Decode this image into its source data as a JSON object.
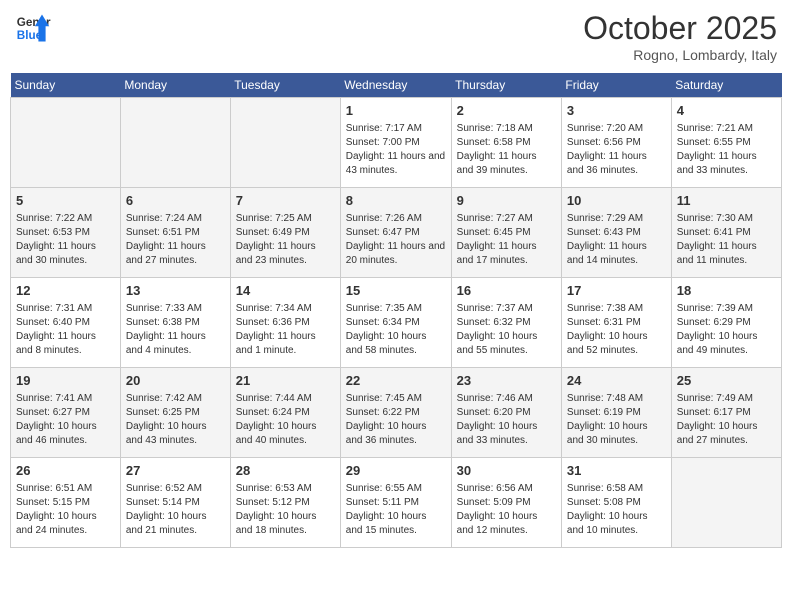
{
  "header": {
    "logo_general": "General",
    "logo_blue": "Blue",
    "month": "October 2025",
    "location": "Rogno, Lombardy, Italy"
  },
  "weekdays": [
    "Sunday",
    "Monday",
    "Tuesday",
    "Wednesday",
    "Thursday",
    "Friday",
    "Saturday"
  ],
  "weeks": [
    {
      "days": [
        {
          "num": "",
          "empty": true
        },
        {
          "num": "",
          "empty": true
        },
        {
          "num": "",
          "empty": true
        },
        {
          "num": "1",
          "sunrise": "7:17 AM",
          "sunset": "7:00 PM",
          "daylight": "11 hours and 43 minutes."
        },
        {
          "num": "2",
          "sunrise": "7:18 AM",
          "sunset": "6:58 PM",
          "daylight": "11 hours and 39 minutes."
        },
        {
          "num": "3",
          "sunrise": "7:20 AM",
          "sunset": "6:56 PM",
          "daylight": "11 hours and 36 minutes."
        },
        {
          "num": "4",
          "sunrise": "7:21 AM",
          "sunset": "6:55 PM",
          "daylight": "11 hours and 33 minutes."
        }
      ]
    },
    {
      "days": [
        {
          "num": "5",
          "sunrise": "7:22 AM",
          "sunset": "6:53 PM",
          "daylight": "11 hours and 30 minutes."
        },
        {
          "num": "6",
          "sunrise": "7:24 AM",
          "sunset": "6:51 PM",
          "daylight": "11 hours and 27 minutes."
        },
        {
          "num": "7",
          "sunrise": "7:25 AM",
          "sunset": "6:49 PM",
          "daylight": "11 hours and 23 minutes."
        },
        {
          "num": "8",
          "sunrise": "7:26 AM",
          "sunset": "6:47 PM",
          "daylight": "11 hours and 20 minutes."
        },
        {
          "num": "9",
          "sunrise": "7:27 AM",
          "sunset": "6:45 PM",
          "daylight": "11 hours and 17 minutes."
        },
        {
          "num": "10",
          "sunrise": "7:29 AM",
          "sunset": "6:43 PM",
          "daylight": "11 hours and 14 minutes."
        },
        {
          "num": "11",
          "sunrise": "7:30 AM",
          "sunset": "6:41 PM",
          "daylight": "11 hours and 11 minutes."
        }
      ]
    },
    {
      "days": [
        {
          "num": "12",
          "sunrise": "7:31 AM",
          "sunset": "6:40 PM",
          "daylight": "11 hours and 8 minutes."
        },
        {
          "num": "13",
          "sunrise": "7:33 AM",
          "sunset": "6:38 PM",
          "daylight": "11 hours and 4 minutes."
        },
        {
          "num": "14",
          "sunrise": "7:34 AM",
          "sunset": "6:36 PM",
          "daylight": "11 hours and 1 minute."
        },
        {
          "num": "15",
          "sunrise": "7:35 AM",
          "sunset": "6:34 PM",
          "daylight": "10 hours and 58 minutes."
        },
        {
          "num": "16",
          "sunrise": "7:37 AM",
          "sunset": "6:32 PM",
          "daylight": "10 hours and 55 minutes."
        },
        {
          "num": "17",
          "sunrise": "7:38 AM",
          "sunset": "6:31 PM",
          "daylight": "10 hours and 52 minutes."
        },
        {
          "num": "18",
          "sunrise": "7:39 AM",
          "sunset": "6:29 PM",
          "daylight": "10 hours and 49 minutes."
        }
      ]
    },
    {
      "days": [
        {
          "num": "19",
          "sunrise": "7:41 AM",
          "sunset": "6:27 PM",
          "daylight": "10 hours and 46 minutes."
        },
        {
          "num": "20",
          "sunrise": "7:42 AM",
          "sunset": "6:25 PM",
          "daylight": "10 hours and 43 minutes."
        },
        {
          "num": "21",
          "sunrise": "7:44 AM",
          "sunset": "6:24 PM",
          "daylight": "10 hours and 40 minutes."
        },
        {
          "num": "22",
          "sunrise": "7:45 AM",
          "sunset": "6:22 PM",
          "daylight": "10 hours and 36 minutes."
        },
        {
          "num": "23",
          "sunrise": "7:46 AM",
          "sunset": "6:20 PM",
          "daylight": "10 hours and 33 minutes."
        },
        {
          "num": "24",
          "sunrise": "7:48 AM",
          "sunset": "6:19 PM",
          "daylight": "10 hours and 30 minutes."
        },
        {
          "num": "25",
          "sunrise": "7:49 AM",
          "sunset": "6:17 PM",
          "daylight": "10 hours and 27 minutes."
        }
      ]
    },
    {
      "days": [
        {
          "num": "26",
          "sunrise": "6:51 AM",
          "sunset": "5:15 PM",
          "daylight": "10 hours and 24 minutes."
        },
        {
          "num": "27",
          "sunrise": "6:52 AM",
          "sunset": "5:14 PM",
          "daylight": "10 hours and 21 minutes."
        },
        {
          "num": "28",
          "sunrise": "6:53 AM",
          "sunset": "5:12 PM",
          "daylight": "10 hours and 18 minutes."
        },
        {
          "num": "29",
          "sunrise": "6:55 AM",
          "sunset": "5:11 PM",
          "daylight": "10 hours and 15 minutes."
        },
        {
          "num": "30",
          "sunrise": "6:56 AM",
          "sunset": "5:09 PM",
          "daylight": "10 hours and 12 minutes."
        },
        {
          "num": "31",
          "sunrise": "6:58 AM",
          "sunset": "5:08 PM",
          "daylight": "10 hours and 10 minutes."
        },
        {
          "num": "",
          "empty": true
        }
      ]
    }
  ]
}
